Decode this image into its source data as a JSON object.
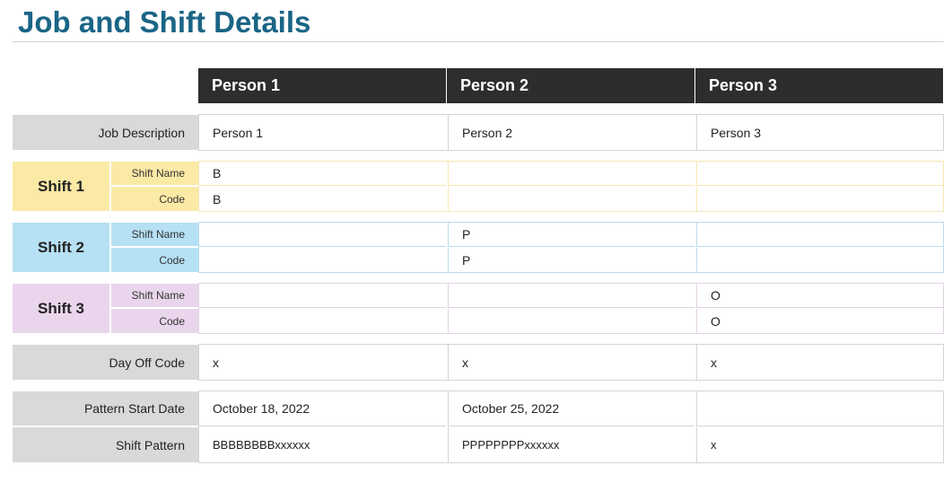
{
  "page": {
    "title": "Job and Shift Details"
  },
  "colors": {
    "title": "#1a6585",
    "header_bg": "#2d2d2d",
    "label_gray": "#d9d9d9",
    "shift1": "#fbe9a6",
    "shift2": "#b6e0f3",
    "shift3": "#ead6ec"
  },
  "columns": [
    {
      "label": "Person 1"
    },
    {
      "label": "Person 2"
    },
    {
      "label": "Person 3"
    }
  ],
  "job_description": {
    "label": "Job Description",
    "values": [
      "Person 1",
      "Person 2",
      "Person 3"
    ]
  },
  "shifts": [
    {
      "title": "Shift 1",
      "name_label": "Shift Name",
      "code_label": "Code",
      "names": [
        "B",
        "",
        ""
      ],
      "codes": [
        "B",
        "",
        ""
      ]
    },
    {
      "title": "Shift 2",
      "name_label": "Shift Name",
      "code_label": "Code",
      "names": [
        "",
        "P",
        ""
      ],
      "codes": [
        "",
        "P",
        ""
      ]
    },
    {
      "title": "Shift 3",
      "name_label": "Shift Name",
      "code_label": "Code",
      "names": [
        "",
        "",
        "O"
      ],
      "codes": [
        "",
        "",
        "O"
      ]
    }
  ],
  "day_off": {
    "label": "Day Off Code",
    "values": [
      "x",
      "x",
      "x"
    ]
  },
  "pattern_start": {
    "label": "Pattern Start Date",
    "values": [
      "October 18, 2022",
      "October 25, 2022",
      ""
    ]
  },
  "shift_pattern": {
    "label": "Shift Pattern",
    "values": [
      "BBBBBBBBxxxxxx",
      "PPPPPPPPxxxxxx",
      "x"
    ]
  }
}
